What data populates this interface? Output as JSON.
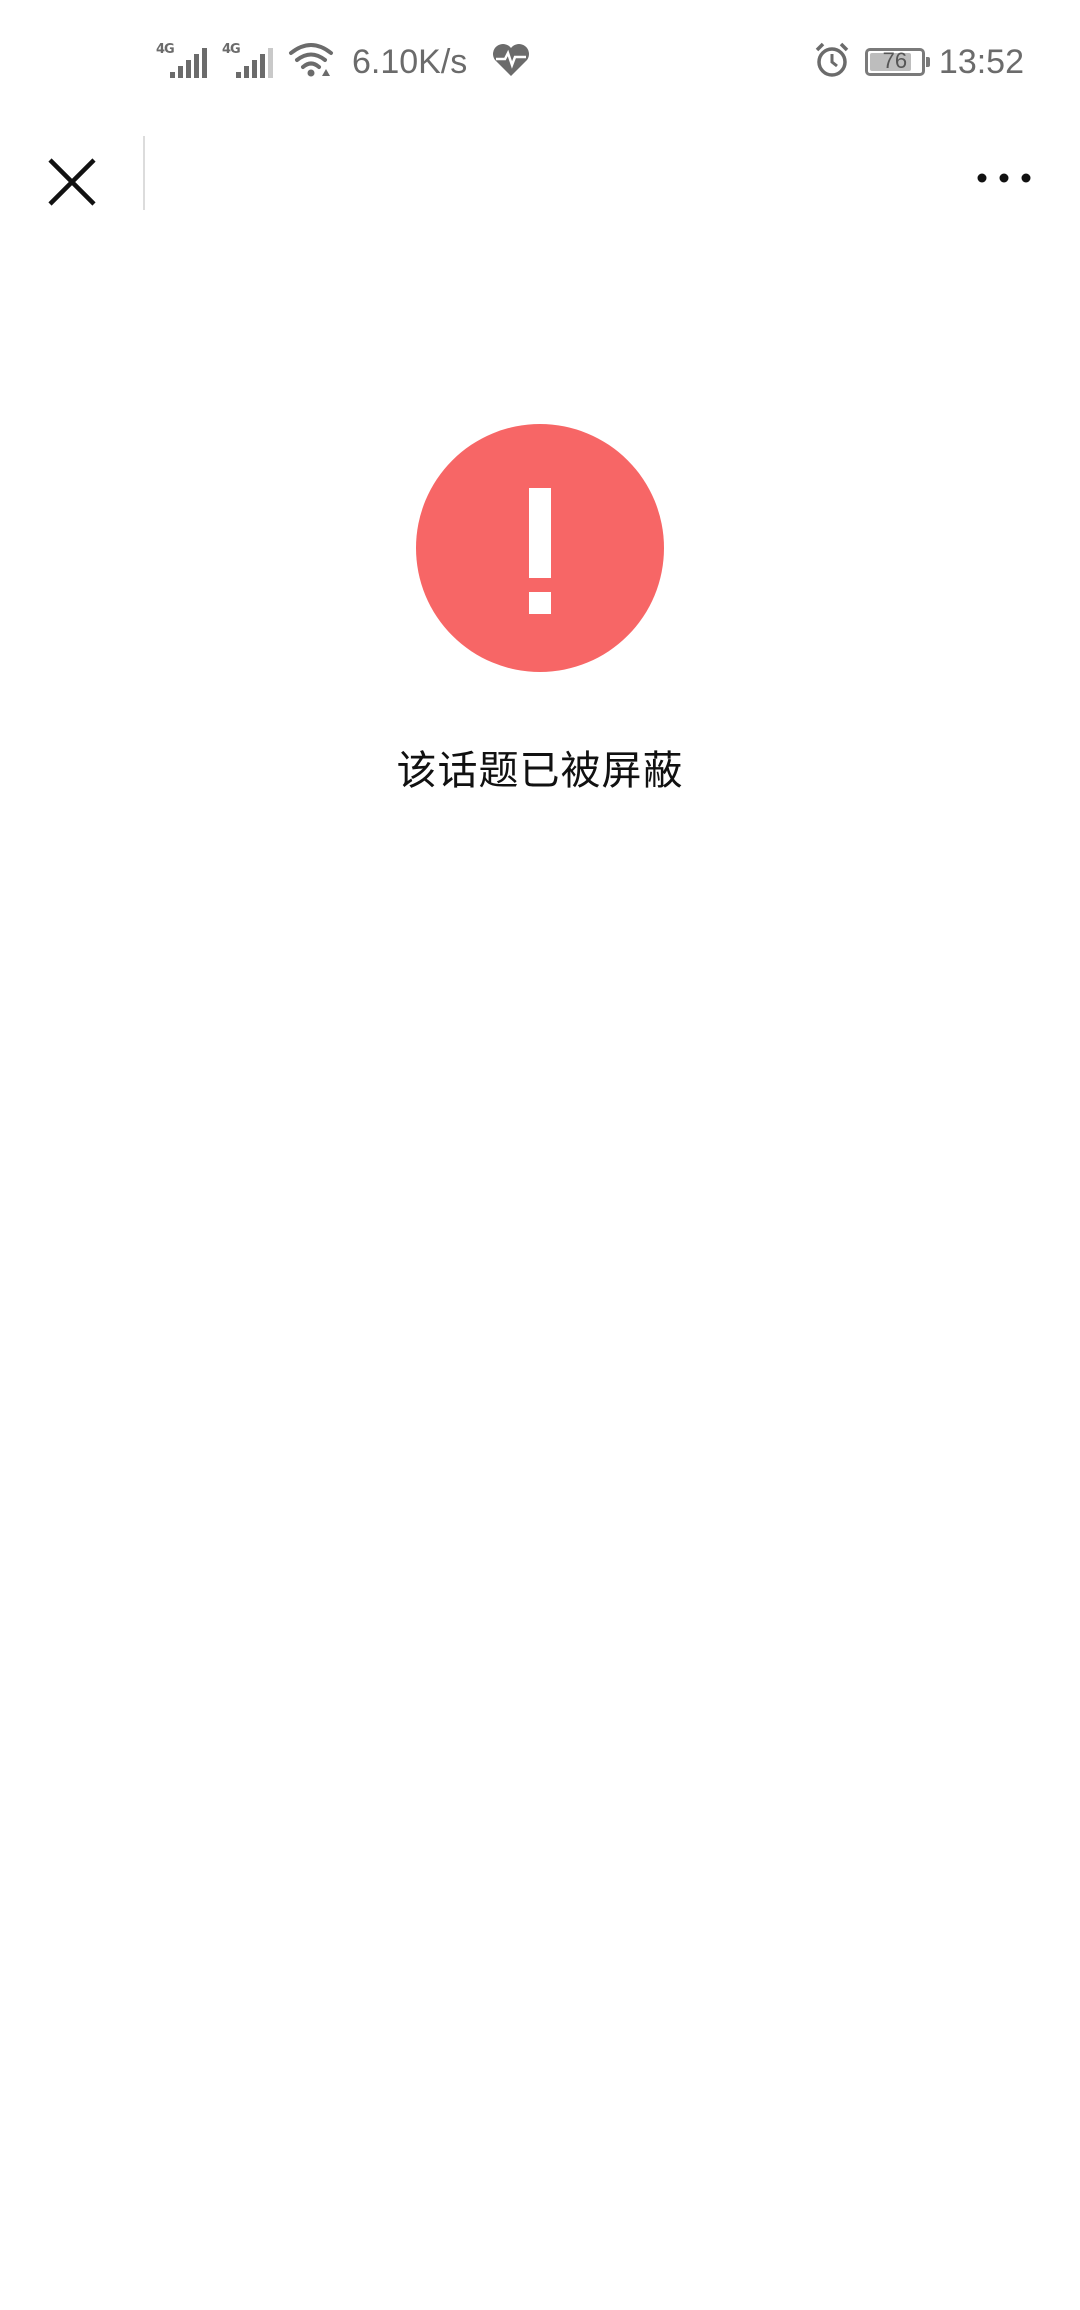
{
  "status_bar": {
    "network_1": "4G",
    "network_2": "4G",
    "speed": "6.10K/s",
    "battery": "76",
    "battery_level_percent": 76,
    "time": "13:52",
    "icons": [
      "signal-icon",
      "wifi-icon",
      "health-heart-icon",
      "alarm-icon",
      "battery-icon"
    ]
  },
  "nav": {
    "close_icon": "close-icon",
    "more_icon": "more-horizontal-icon"
  },
  "message": {
    "icon": "exclamation-icon",
    "text": "该话题已被屏蔽",
    "accent_color": "#f76666"
  }
}
